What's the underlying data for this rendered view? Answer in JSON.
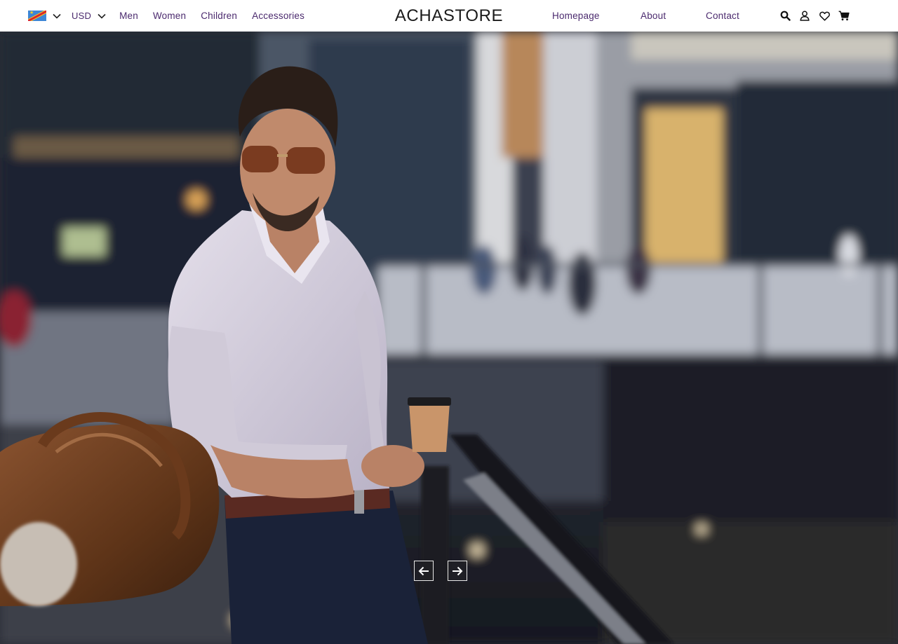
{
  "header": {
    "currency": "USD",
    "menu": [
      "Men",
      "Women",
      "Children",
      "Accessories"
    ],
    "brand": "ACHASTORE",
    "links": [
      "Homepage",
      "About",
      "Contact"
    ]
  },
  "icons": {
    "flag": "drc-flag-icon",
    "search": "search-icon",
    "account": "user-icon",
    "wishlist": "heart-icon",
    "cart": "cart-icon",
    "prev": "arrow-left-icon",
    "next": "arrow-right-icon"
  },
  "colors": {
    "nav_text": "#4b2a6e",
    "brand_text": "#1b1b1b"
  }
}
